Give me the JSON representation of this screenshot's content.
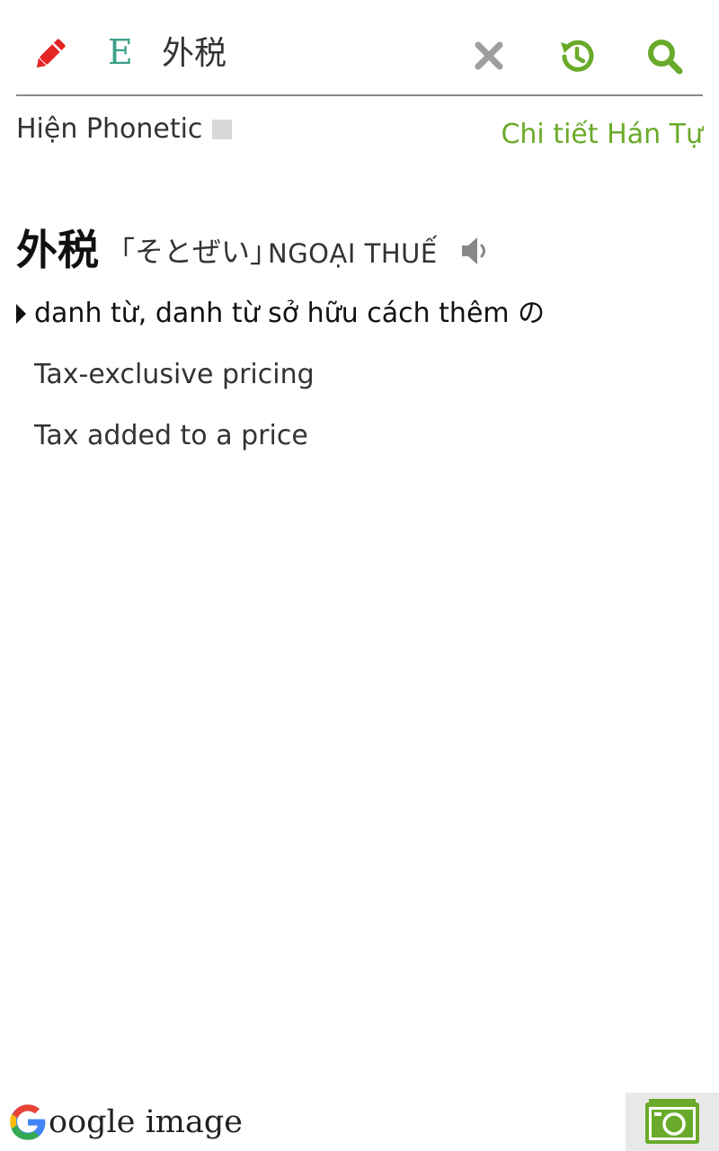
{
  "colors": {
    "accent_green": "#6aaa2a",
    "pencil_red": "#e52424",
    "lang_teal": "#3aa08a",
    "clear_gray": "#9e9e9e"
  },
  "toolbar": {
    "edit_icon": "pencil-icon",
    "language_label": "E",
    "query_value": "外税",
    "clear_icon": "close-icon",
    "history_icon": "history-icon",
    "search_icon": "search-icon"
  },
  "options": {
    "phonetic_label": "Hiện Phonetic",
    "phonetic_checked": false,
    "kanji_detail_link": "Chi tiết Hán Tự"
  },
  "entry": {
    "word": "外税",
    "reading": "「そとぜい」",
    "hanviet": "NGOẠI THUẾ",
    "speaker_icon": "speaker-icon",
    "part_of_speech": "danh từ, danh từ sở hữu cách thêm の",
    "meanings": [
      "Tax-exclusive pricing",
      "Tax added to a price"
    ]
  },
  "footer": {
    "google_image_label": "oogle image",
    "camera_icon": "camera-icon"
  }
}
